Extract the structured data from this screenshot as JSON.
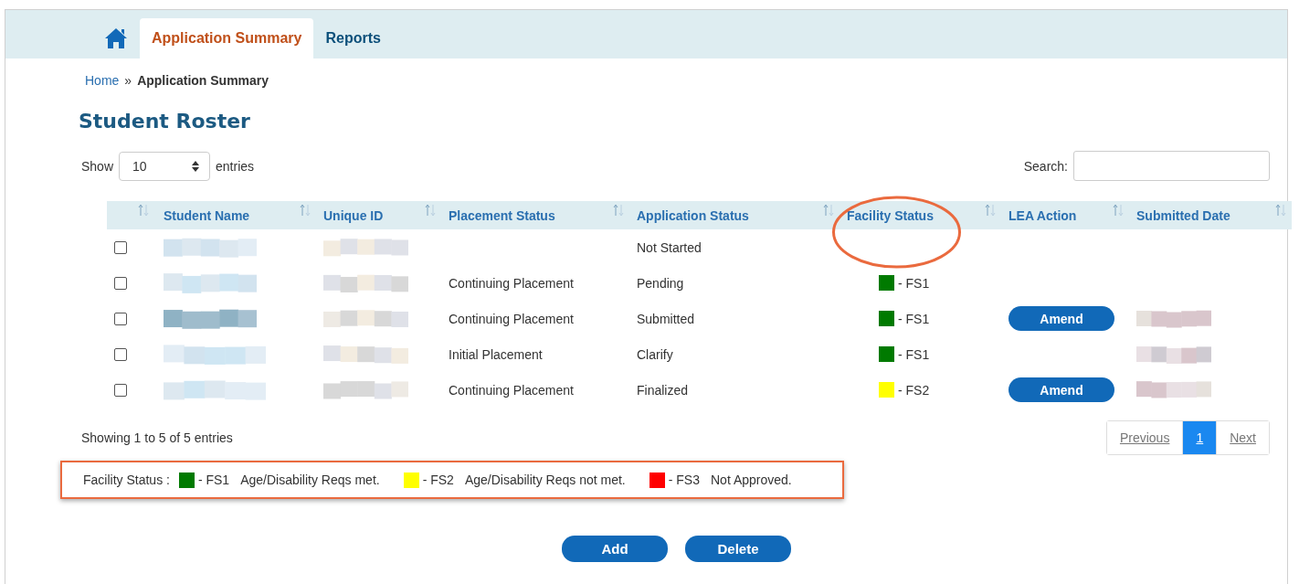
{
  "nav": {
    "tabs": [
      {
        "kind": "home",
        "selected": false
      },
      {
        "kind": "text",
        "label": "Application Summary",
        "selected": true
      },
      {
        "kind": "text",
        "label": "Reports",
        "selected": false
      }
    ]
  },
  "breadcrumb": {
    "link": "Home",
    "separator": "»",
    "current": "Application Summary"
  },
  "title": "Student Roster",
  "length_menu": {
    "before": "Show",
    "value": "10",
    "after": "entries"
  },
  "search": {
    "label": "Search:"
  },
  "table": {
    "columns": [
      "Student Name",
      "Unique ID",
      "Placement Status",
      "Application Status",
      "Facility Status",
      "LEA Action",
      "Submitted Date"
    ],
    "rows": [
      {
        "checked": false,
        "placement_status": "",
        "application_status": "Not Started"
      },
      {
        "checked": false,
        "placement_status": "Continuing Placement",
        "application_status": "Pending",
        "facility_status": {
          "code": "- FS1",
          "color": "#007a00"
        }
      },
      {
        "checked": false,
        "placement_status": "Continuing Placement",
        "application_status": "Submitted",
        "facility_status": {
          "code": "- FS1",
          "color": "#007a00"
        },
        "lea_action": "Amend"
      },
      {
        "checked": false,
        "placement_status": "Initial Placement",
        "application_status": "Clarify",
        "facility_status": {
          "code": "- FS1",
          "color": "#007a00"
        }
      },
      {
        "checked": false,
        "placement_status": "Continuing Placement",
        "application_status": "Finalized",
        "facility_status": {
          "code": "- FS2",
          "color": "#ffff00"
        },
        "lea_action": "Amend"
      }
    ]
  },
  "info": "Showing 1 to 5 of 5 entries",
  "pagination": [
    {
      "label": "Previous",
      "selected": false
    },
    {
      "label": "1",
      "selected": true
    },
    {
      "label": "Next",
      "selected": false
    }
  ],
  "legend": {
    "label": "Facility Status :",
    "items": [
      {
        "code": "- FS1",
        "text": "Age/Disability Reqs met.",
        "color": "#007a00"
      },
      {
        "code": "- FS2",
        "text": "Age/Disability Reqs not met.",
        "color": "#ffff00"
      },
      {
        "code": "- FS3",
        "text": "Not Approved.",
        "color": "#ff0000"
      }
    ]
  },
  "buttons": [
    "Add",
    "Delete"
  ]
}
